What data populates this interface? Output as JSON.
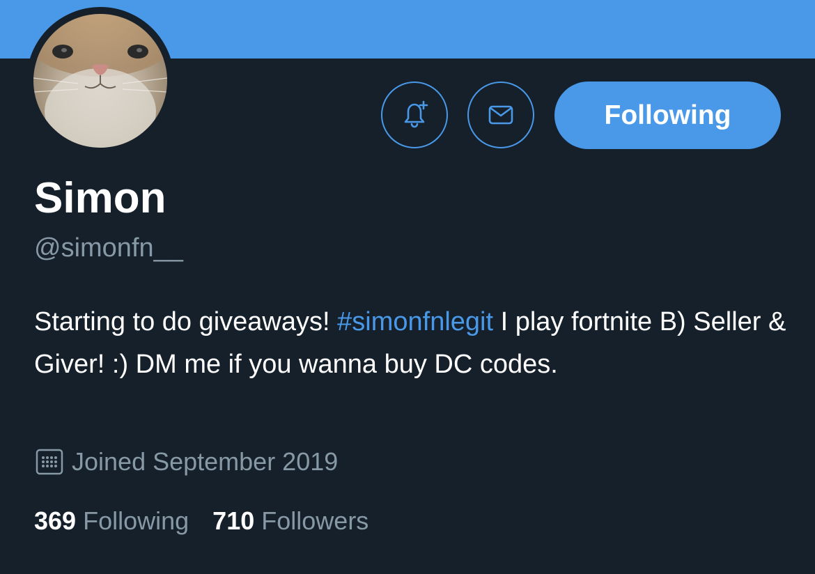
{
  "profile": {
    "name": "Simon",
    "handle": "@simonfn__",
    "bio": {
      "before": "Starting to do giveaways! ",
      "hashtag": "#simonfnlegit",
      "after": " I play fortnite B) Seller & Giver! :) DM me if you wanna buy DC codes."
    },
    "joined": "Joined September 2019"
  },
  "actions": {
    "notify_icon": "bell-plus-icon",
    "message_icon": "mail-icon",
    "follow_label": "Following"
  },
  "stats": {
    "following_count": "369",
    "following_label": "Following",
    "followers_count": "710",
    "followers_label": "Followers"
  },
  "colors": {
    "background": "#15202b",
    "accent": "#4a99e9",
    "text_primary": "#ffffff",
    "text_secondary": "#8899a6"
  }
}
